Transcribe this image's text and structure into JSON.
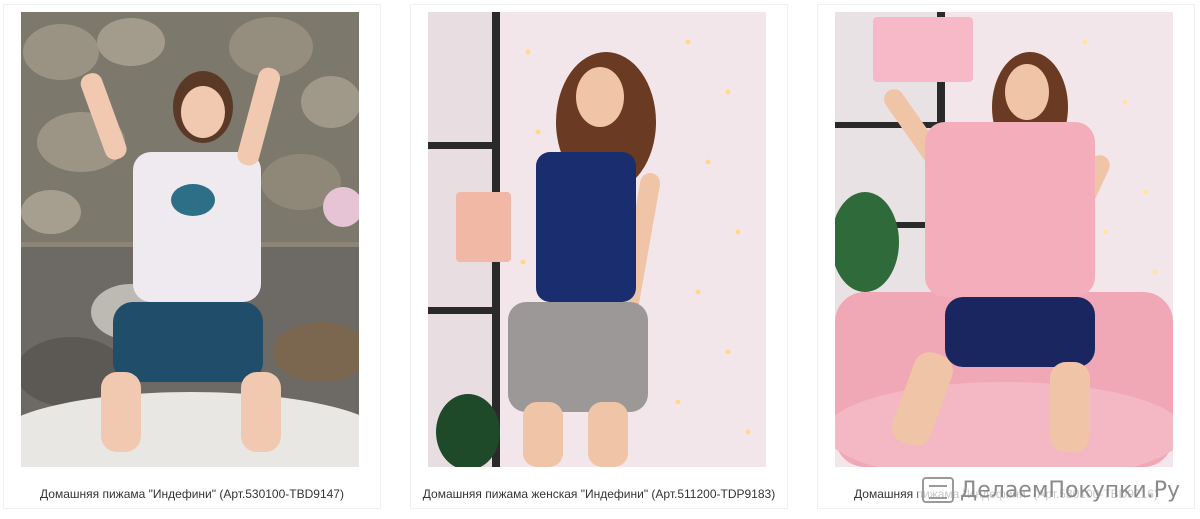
{
  "products": [
    {
      "caption": "Домашняя пижама \"Индефини\" (Арт.530100-TBD9147)",
      "image": "woman-kneeling-white-tee-blue-shorts-stone-wall"
    },
    {
      "caption": "Домашняя пижама женская \"Индефини\" (Арт.511200-TDP9183)",
      "image": "woman-navy-velvet-camisole-lace-shorts-fairy-lights"
    },
    {
      "caption": "Домашняя пижама \"Индефини\" (Арт.530100-TBD9216)",
      "image": "woman-pink-lace-top-velvet-shorts-pink-chair"
    }
  ],
  "colors": {
    "caption_text": "#333333",
    "card_border": "#f0f0f0",
    "watermark": "#8a8a8a"
  },
  "watermark": {
    "text": "ДелаемПокупки.Ру",
    "icon": "shopping-cart-icon"
  }
}
